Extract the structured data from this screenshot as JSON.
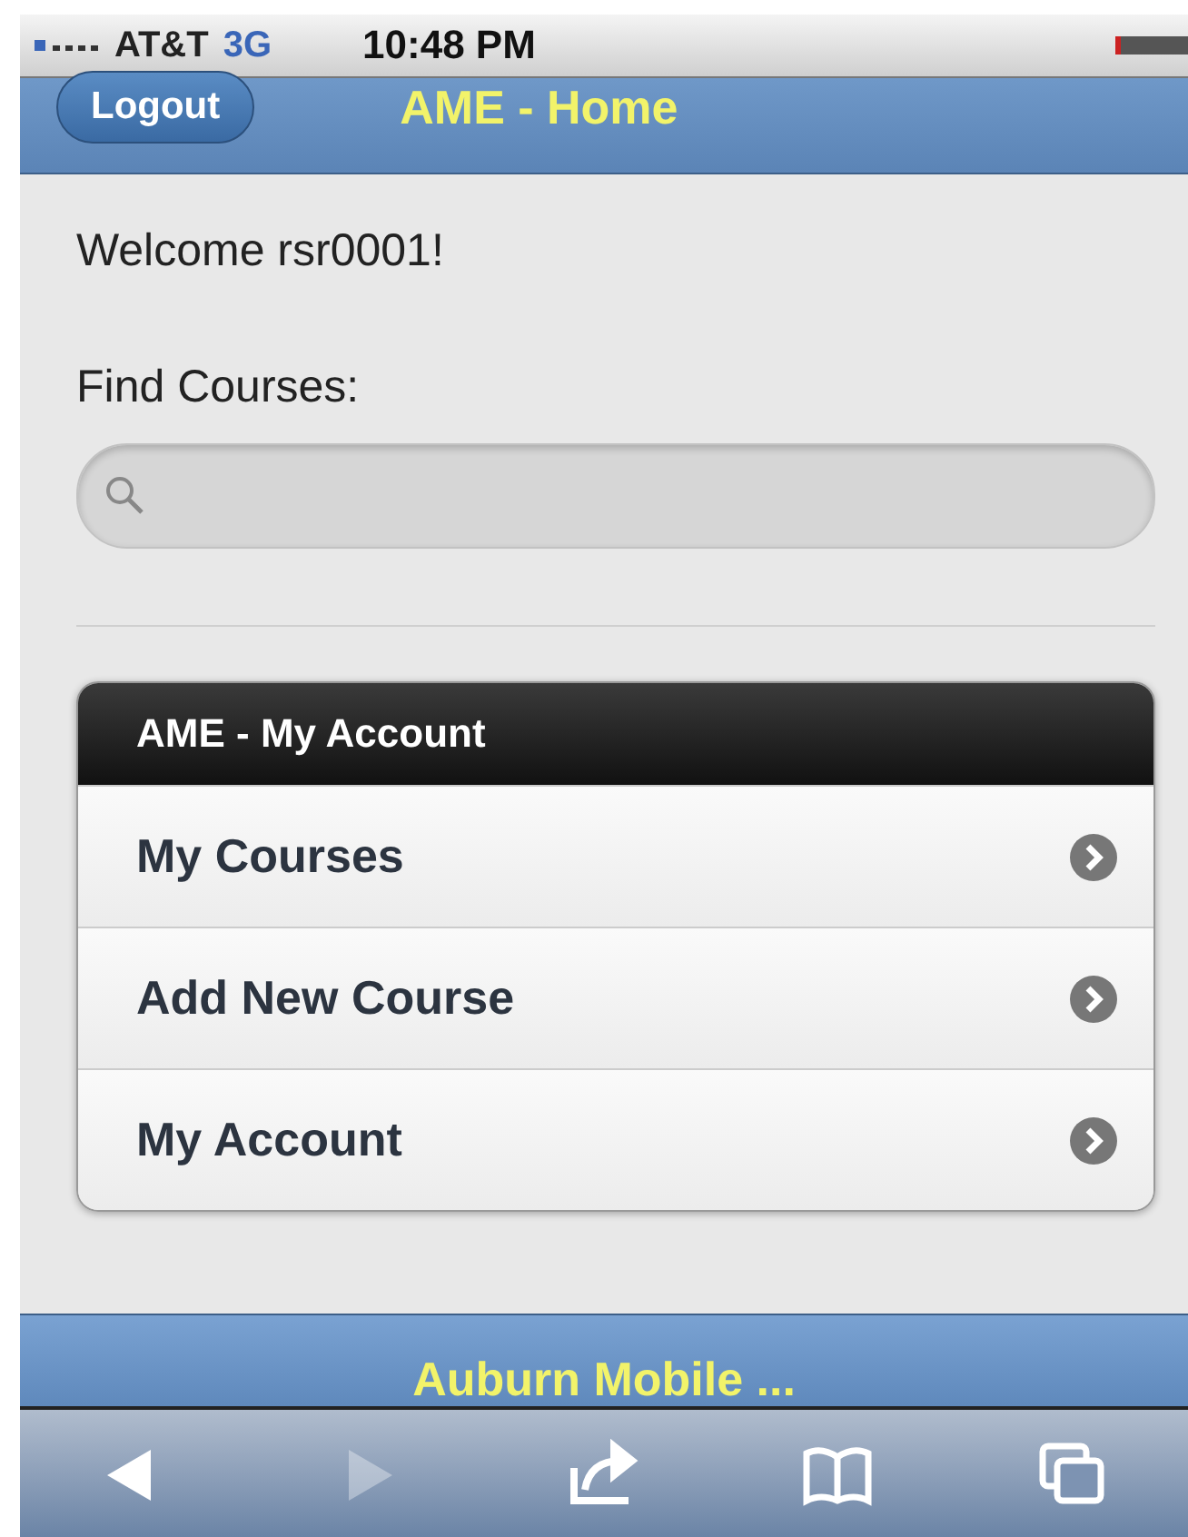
{
  "status_bar": {
    "carrier": "AT&T",
    "network": "3G",
    "time": "10:48 PM"
  },
  "header": {
    "button": "Logout",
    "title": "AME - Home"
  },
  "welcome": "Welcome rsr0001!",
  "search": {
    "label": "Find Courses:"
  },
  "menu": {
    "title": "AME - My Account",
    "items": [
      {
        "label": "My Courses"
      },
      {
        "label": "Add New Course"
      },
      {
        "label": "My Account"
      }
    ]
  },
  "footer": {
    "title": "Auburn Mobile ..."
  },
  "toolbar": [
    {
      "kind": "back",
      "disabled": false
    },
    {
      "kind": "forward",
      "disabled": true
    },
    {
      "kind": "share",
      "disabled": false
    },
    {
      "kind": "bookmarks",
      "disabled": false
    },
    {
      "kind": "tabs",
      "disabled": false
    }
  ]
}
